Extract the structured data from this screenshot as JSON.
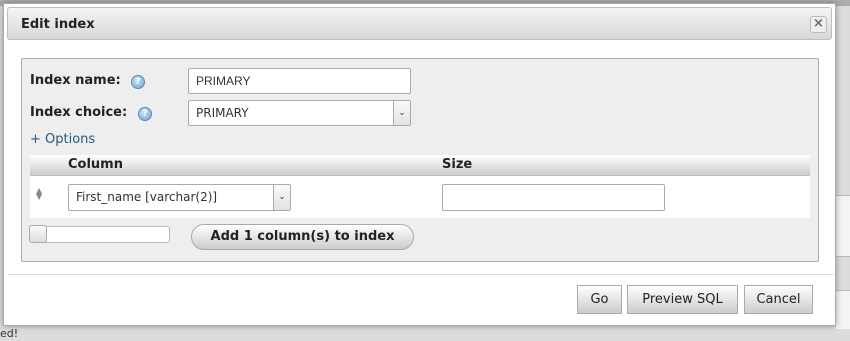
{
  "background": {
    "bottom_text": "ed!"
  },
  "dialog": {
    "title": "Edit index",
    "close_symbol": "×",
    "index_name": {
      "label": "Index name:",
      "value": "PRIMARY"
    },
    "index_choice": {
      "label": "Index choice:",
      "value": "PRIMARY"
    },
    "options_link": "+ Options",
    "help_symbol": "?",
    "table": {
      "headers": [
        "Column",
        "Size"
      ],
      "rows": [
        {
          "column_value": "First_name [varchar(2)]",
          "size_value": ""
        }
      ]
    },
    "add_columns_button": "Add 1 column(s) to index",
    "buttons": {
      "go": "Go",
      "preview_sql": "Preview SQL",
      "cancel": "Cancel"
    }
  }
}
